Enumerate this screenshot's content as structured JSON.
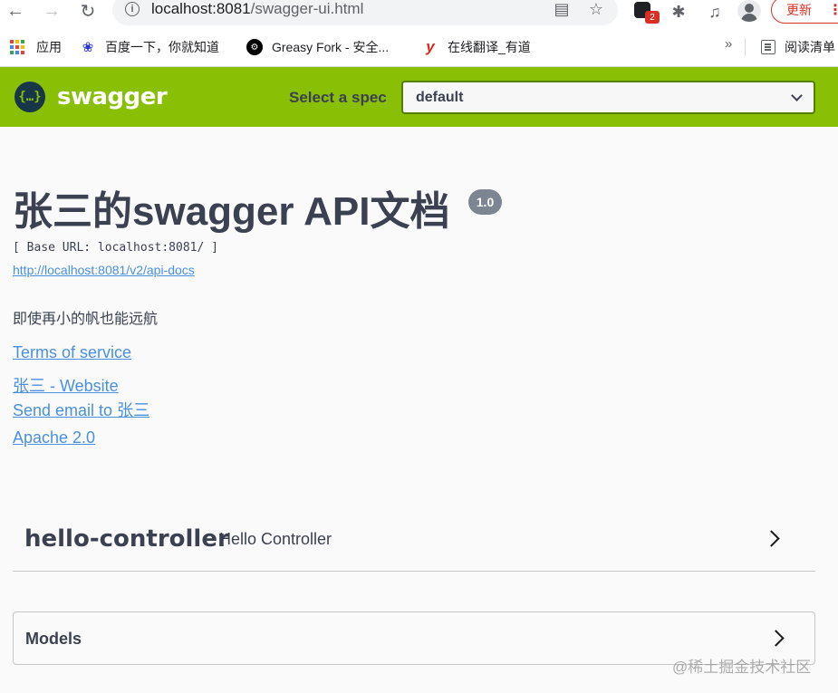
{
  "browser": {
    "url_host": "localhost:8081",
    "url_path": "/swagger-ui.html",
    "update_label": "更新",
    "extension_badge": "2",
    "bookmarks": [
      {
        "label": "应用"
      },
      {
        "label": "百度一下，你就知道"
      },
      {
        "label": "Greasy Fork - 安全..."
      },
      {
        "label": "在线翻译_有道"
      }
    ],
    "more_label": "»",
    "reading_list_label": "阅读清单"
  },
  "swagger": {
    "logo_text": "swagger",
    "spec_label": "Select a spec",
    "spec_value": "default"
  },
  "info": {
    "title": "张三的swagger API文档",
    "version": "1.0",
    "base_url": "[ Base URL: localhost:8081/ ]",
    "api_docs_url": "http://localhost:8081/v2/api-docs",
    "description": "即使再小的帆也能远航",
    "terms_link": "Terms of service",
    "website_link": "张三 - Website",
    "email_link": "Send email to 张三",
    "license_link": "Apache 2.0"
  },
  "tags": [
    {
      "name": "hello-controller",
      "description": "Hello Controller"
    }
  ],
  "models": {
    "title": "Models"
  },
  "watermark": "@稀土掘金技术社区",
  "colors": {
    "header_bg": "#89bf04",
    "link": "#4990e2",
    "text": "#3b4151",
    "badge_bg": "#7d8492"
  }
}
